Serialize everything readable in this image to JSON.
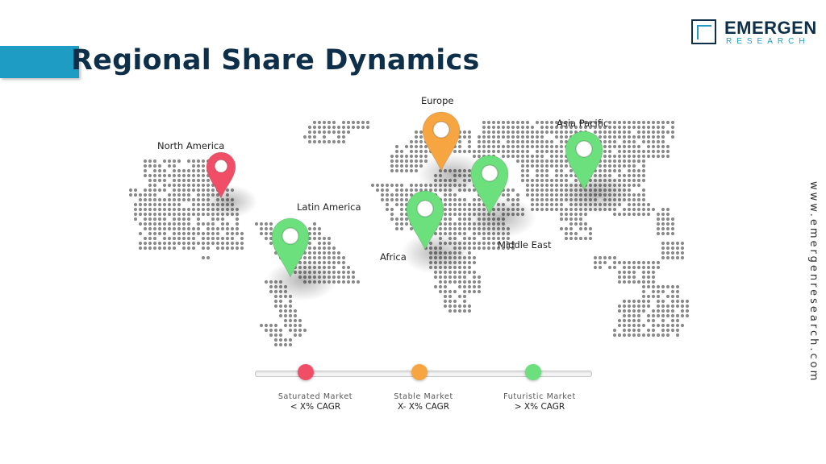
{
  "header": {
    "title": "Regional Share Dynamics"
  },
  "logo": {
    "name": "EMERGEN",
    "sub": "RESEARCH",
    "icon": "square-bracket-logo-icon"
  },
  "website": "www.emergenresearch.com",
  "colors": {
    "accent": "#1e9cc4",
    "navy": "#0e2f49",
    "saturated": "#f04e67",
    "stable": "#f7a540",
    "futuristic": "#6be07c",
    "dots": "#8a8a8a"
  },
  "regions": [
    {
      "name": "North America",
      "status": "saturated"
    },
    {
      "name": "Europe",
      "status": "stable"
    },
    {
      "name": "Asia Pacific",
      "status": "futuristic"
    },
    {
      "name": "Latin America",
      "status": "futuristic"
    },
    {
      "name": "Middle East",
      "status": "futuristic"
    },
    {
      "name": "Africa",
      "status": "futuristic"
    }
  ],
  "legend": [
    {
      "title": "Saturated Market",
      "sub": "< X% CAGR",
      "status": "saturated"
    },
    {
      "title": "Stable Market",
      "sub": "X- X% CAGR",
      "status": "stable"
    },
    {
      "title": "Futuristic Market",
      "sub": "> X% CAGR",
      "status": "futuristic"
    }
  ]
}
